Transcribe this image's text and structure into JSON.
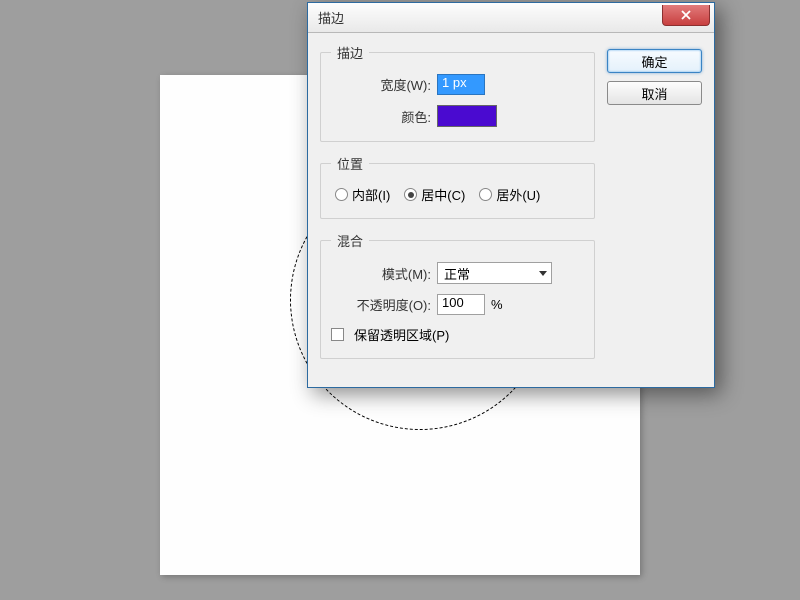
{
  "dialog": {
    "title": "描边",
    "stroke_group": {
      "legend": "描边",
      "width_label": "宽度(W):",
      "width_value": "1 px",
      "color_label": "颜色:",
      "color_hex": "#4a0ad0"
    },
    "position_group": {
      "legend": "位置",
      "options": {
        "inside": "内部(I)",
        "center": "居中(C)",
        "outside": "居外(U)"
      },
      "selected": "center"
    },
    "blend_group": {
      "legend": "混合",
      "mode_label": "模式(M):",
      "mode_value": "正常",
      "opacity_label": "不透明度(O):",
      "opacity_value": "100",
      "opacity_suffix": "%",
      "preserve_label": "保留透明区域(P)",
      "preserve_checked": false
    },
    "buttons": {
      "ok": "确定",
      "cancel": "取消"
    }
  }
}
